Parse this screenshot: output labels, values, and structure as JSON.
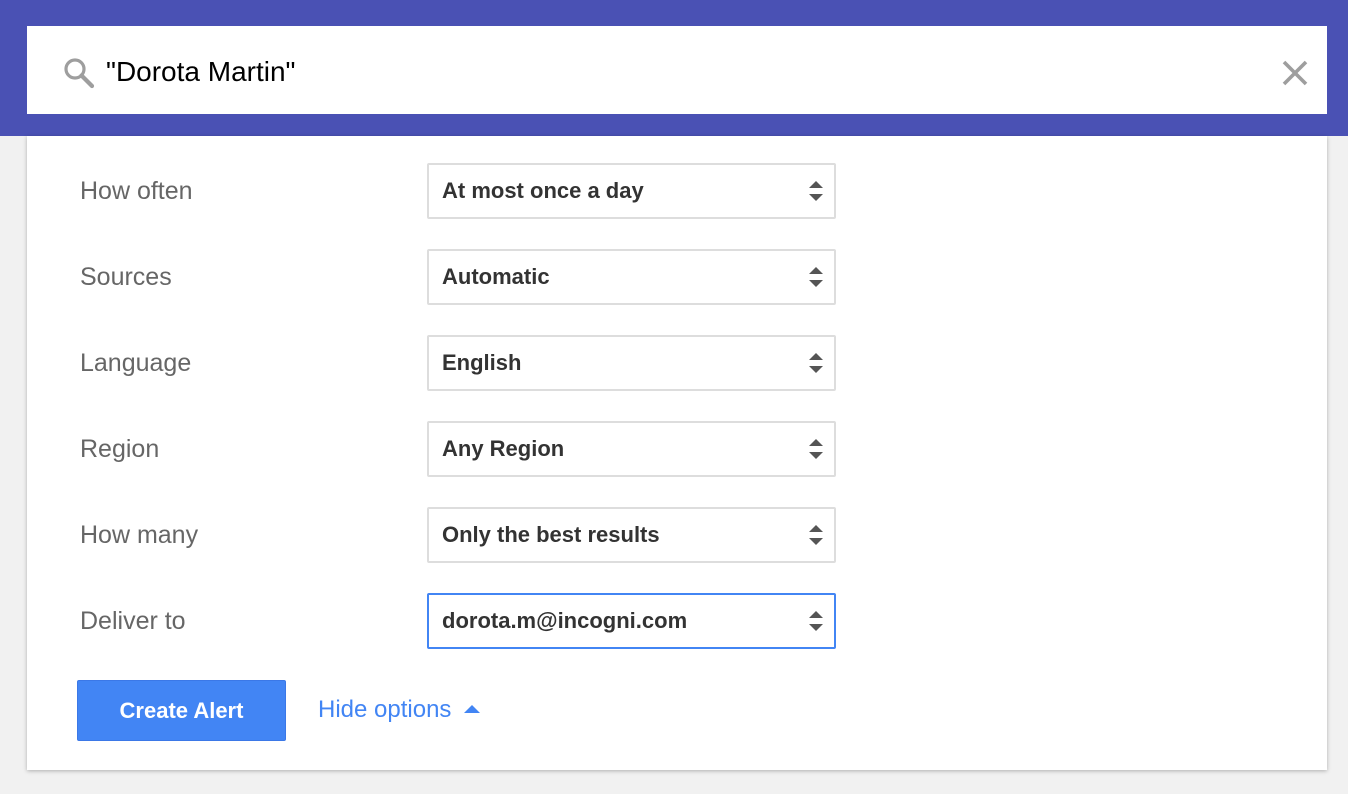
{
  "search": {
    "query": "\"Dorota Martin\"",
    "icon": "search-icon",
    "clear_icon": "close-icon"
  },
  "options": [
    {
      "label": "How often",
      "value": "At most once a day",
      "focused": false
    },
    {
      "label": "Sources",
      "value": "Automatic",
      "focused": false
    },
    {
      "label": "Language",
      "value": "English",
      "focused": false
    },
    {
      "label": "Region",
      "value": "Any Region",
      "focused": false
    },
    {
      "label": "How many",
      "value": "Only the best results",
      "focused": false
    },
    {
      "label": "Deliver to",
      "value": "dorota.m@incogni.com",
      "focused": true
    }
  ],
  "actions": {
    "create_label": "Create Alert",
    "hide_options_label": "Hide options"
  },
  "colors": {
    "header": "#4a51b4",
    "accent": "#4285f4",
    "label_text": "#666666",
    "value_text": "#333333"
  }
}
